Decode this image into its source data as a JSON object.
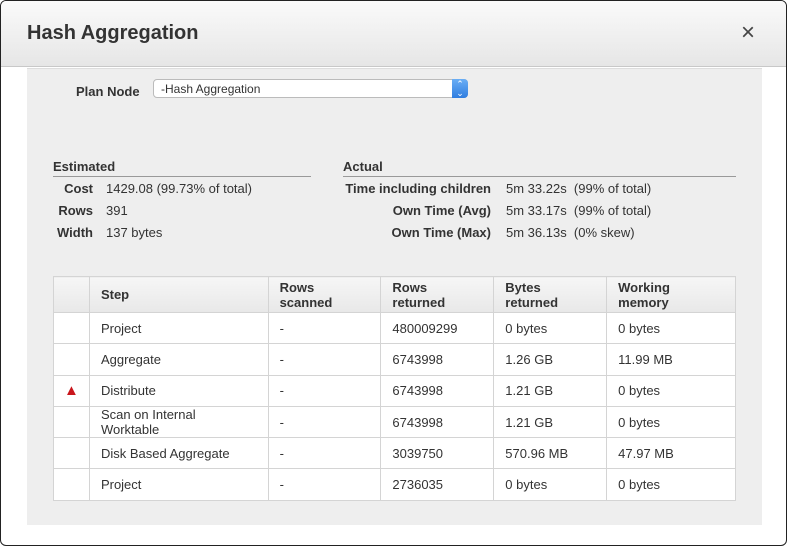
{
  "title": "Hash Aggregation",
  "close_icon": "×",
  "plan_node": {
    "label": "Plan Node",
    "value": "-Hash Aggregation"
  },
  "estimated": {
    "heading": "Estimated",
    "cost_label": "Cost",
    "cost": "1429.08 (99.73% of total)",
    "rows_label": "Rows",
    "rows": "391",
    "width_label": "Width",
    "width": "137 bytes"
  },
  "actual": {
    "heading": "Actual",
    "time_children_label": "Time including children",
    "time_children": "5m 33.22s  (99% of total)",
    "own_avg_label": "Own Time (Avg)",
    "own_avg": "5m 33.17s  (99% of total)",
    "own_max_label": "Own Time (Max)",
    "own_max": "5m 36.13s  (0% skew)"
  },
  "table": {
    "headers": [
      "",
      "Step",
      "Rows scanned",
      "Rows returned",
      "Bytes returned",
      "Working memory"
    ],
    "rows": [
      {
        "warn": "",
        "step": "Project",
        "scanned": "-",
        "returned": "480009299",
        "bytes": "0 bytes",
        "mem": "0 bytes"
      },
      {
        "warn": "",
        "step": "Aggregate",
        "scanned": "-",
        "returned": "6743998",
        "bytes": "1.26 GB",
        "mem": "11.99 MB"
      },
      {
        "warn": "▲",
        "step": "Distribute",
        "scanned": "-",
        "returned": "6743998",
        "bytes": "1.21 GB",
        "mem": "0 bytes"
      },
      {
        "warn": "",
        "step": "Scan on Internal Worktable",
        "scanned": "-",
        "returned": "6743998",
        "bytes": "1.21 GB",
        "mem": "0 bytes"
      },
      {
        "warn": "",
        "step": "Disk Based Aggregate",
        "scanned": "-",
        "returned": "3039750",
        "bytes": "570.96 MB",
        "mem": "47.97 MB"
      },
      {
        "warn": "",
        "step": "Project",
        "scanned": "-",
        "returned": "2736035",
        "bytes": "0 bytes",
        "mem": "0 bytes"
      }
    ]
  }
}
